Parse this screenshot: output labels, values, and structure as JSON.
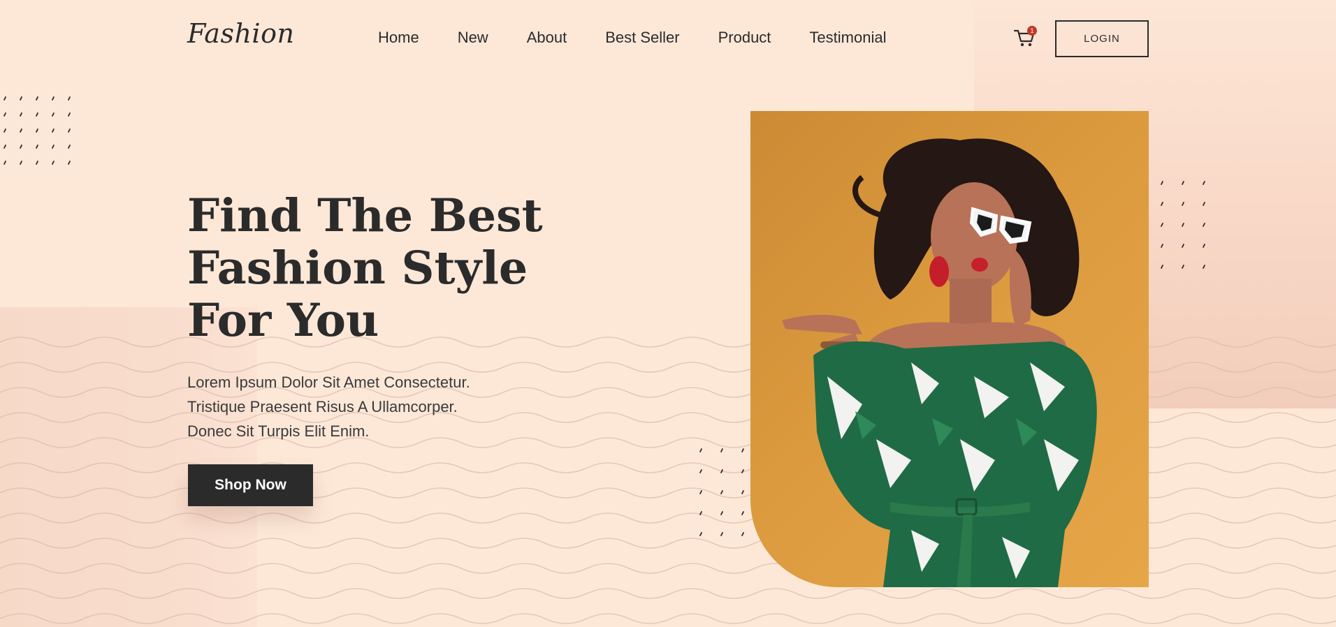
{
  "brand": {
    "logo_text": "Fashion"
  },
  "nav": {
    "items": [
      {
        "label": "Home"
      },
      {
        "label": "New"
      },
      {
        "label": "About"
      },
      {
        "label": "Best Seller"
      },
      {
        "label": "Product"
      },
      {
        "label": "Testimonial"
      }
    ],
    "cart_icon": "cart-icon",
    "cart_count": "1",
    "login_label": "LOGIN"
  },
  "hero": {
    "title_lines": [
      "Find The Best",
      "Fashion Style",
      "For You"
    ],
    "description_lines": [
      "Lorem Ipsum Dolor Sit Amet Consectetur.",
      "Tristique Praesent Risus A Ullamcorper.",
      "Donec Sit Turpis Elit Enim."
    ],
    "cta_label": "Shop Now"
  },
  "colors": {
    "background": "#fde8d8",
    "text": "#2b2b2b",
    "button_bg": "#2b2b2b",
    "photo_bg": "#d9963c",
    "badge": "#c0392b",
    "dress_green": "#1f6b45"
  }
}
